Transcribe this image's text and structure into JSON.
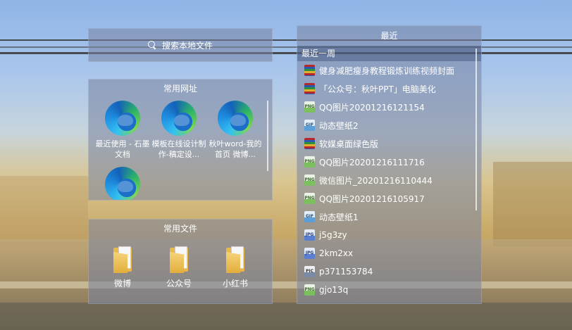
{
  "search": {
    "placeholder": "搜索本地文件"
  },
  "sites": {
    "title": "常用网址",
    "items": [
      {
        "label": "最近使用 - 石墨文档",
        "icon": "edge-browser-icon"
      },
      {
        "label": "模板在线设计制作-稿定设...",
        "icon": "edge-browser-icon"
      },
      {
        "label": "秋叶word-我的首页 微博...",
        "icon": "edge-browser-icon"
      },
      {
        "label": "",
        "icon": "edge-browser-icon"
      }
    ]
  },
  "files": {
    "title": "常用文件",
    "items": [
      {
        "label": "微博",
        "icon": "folder-icon"
      },
      {
        "label": "公众号",
        "icon": "folder-icon"
      },
      {
        "label": "小红书",
        "icon": "folder-icon"
      }
    ]
  },
  "recent": {
    "title": "最近",
    "section": "最近一周",
    "items": [
      {
        "name": "健身减肥瘦身教程锻炼训练视频封面",
        "type": "archive"
      },
      {
        "name": "「公众号：秋叶PPT」电脑美化",
        "type": "archive"
      },
      {
        "name": "QQ图片20201216121154",
        "type": "png"
      },
      {
        "name": "动态壁纸2",
        "type": "gif"
      },
      {
        "name": "软媒桌面绿色版",
        "type": "archive"
      },
      {
        "name": "QQ图片20201216111716",
        "type": "png"
      },
      {
        "name": "微信图片_20201216110444",
        "type": "png"
      },
      {
        "name": "QQ图片20201216105917",
        "type": "png"
      },
      {
        "name": "动态壁纸1",
        "type": "gif"
      },
      {
        "name": "j5g3zy",
        "type": "jpg"
      },
      {
        "name": "2km2xx",
        "type": "jpg"
      },
      {
        "name": "p371153784",
        "type": "pic"
      },
      {
        "name": "gjo13q",
        "type": "png"
      }
    ]
  },
  "icon_text": {
    "png": "PNG",
    "gif": "GIF",
    "jpg": "JPG",
    "pic": "PIC"
  }
}
